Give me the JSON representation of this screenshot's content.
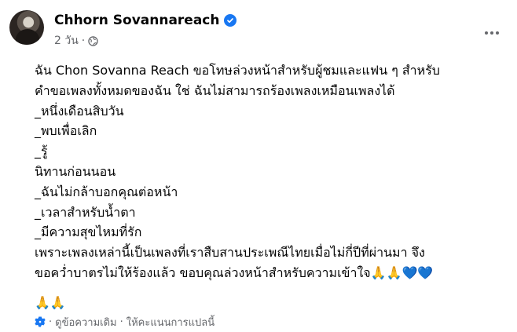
{
  "post": {
    "author": "Chhorn Sovannareach",
    "time": "2 วัน",
    "dot": "·",
    "lines": [
      "ฉัน Chon Sovanna Reach ขอโทษล่วงหน้าสำหรับผู้ชมและแฟน ๆ สำหรับ",
      "คำขอเพลงทั้งหมดของฉัน ใช่ ฉันไม่สามารถร้องเพลงเหมือนเพลงได้",
      "_หนึ่งเดือนสิบวัน",
      "_พบเพื่อเลิก",
      "_รู้",
      "นิทานก่อนนอน",
      "_ฉันไม่กล้าบอกคุณต่อหน้า",
      "_เวลาสำหรับน้ำตา",
      "_มีความสุขไหมที่รัก",
      "เพราะเพลงเหล่านี้เป็นเพลงที่เราสืบสานประเพณีไทยเมื่อไม่กี่ปีที่ผ่านมา จึง",
      "ขอคว่ำบาตรไม่ให้ร้องแล้ว ขอบคุณล่วงหน้าสำหรับความเข้าใจ🙏🙏💙💙"
    ],
    "trailing_emoji": "🙏🙏",
    "translation": {
      "see_original": "ดูข้อความเดิม",
      "separator": "·",
      "rate": "ให้คะแนนการแปลนี้"
    }
  },
  "icons": {
    "verified": "verified-badge-icon",
    "audience": "globe-icon",
    "more": "more-options-icon",
    "translate_settings": "gear-icon"
  },
  "colors": {
    "accent": "#1877f2",
    "secondary_text": "#65676b",
    "primary_text": "#050505"
  }
}
